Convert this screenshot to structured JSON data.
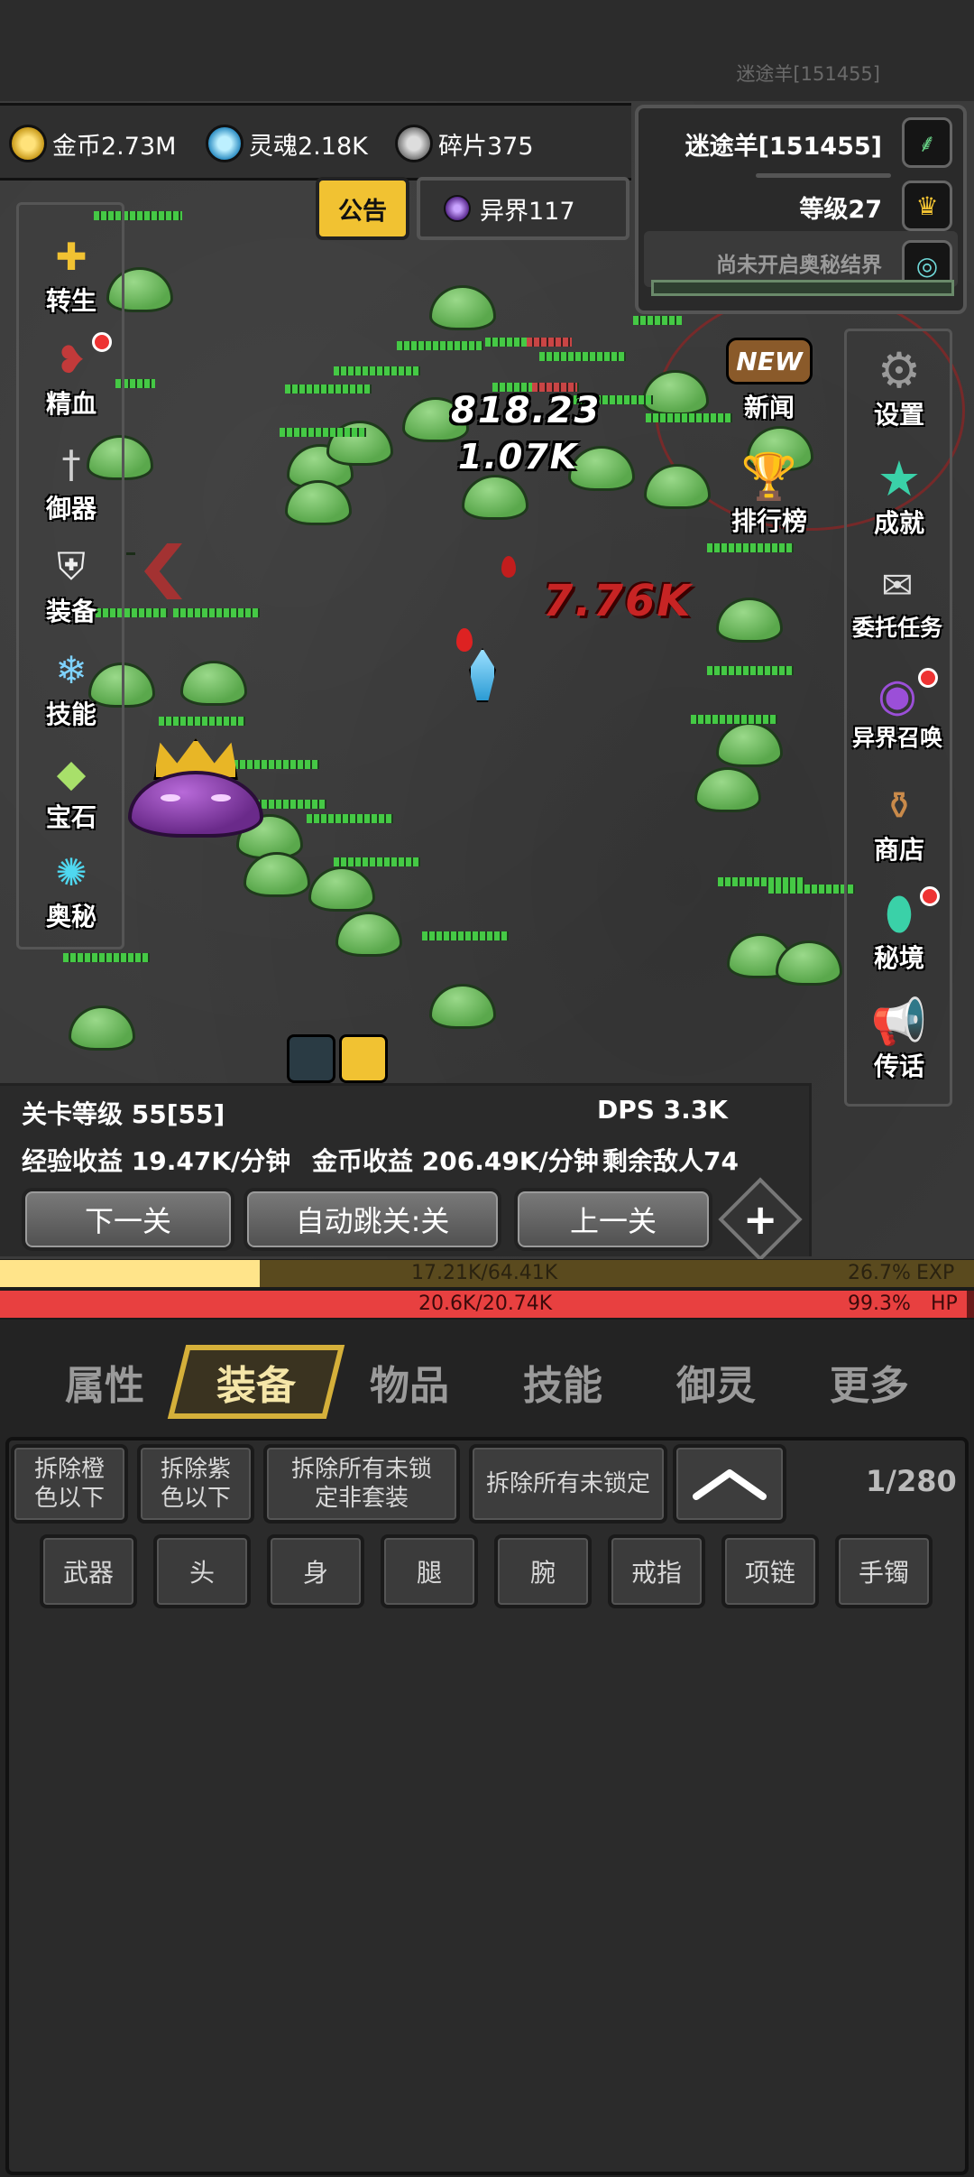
{
  "top": {
    "player_name_faint": "迷途羊[151455]"
  },
  "resources": [
    {
      "icon": "gold-coin-icon",
      "label": "金币2.73M"
    },
    {
      "icon": "soul-icon",
      "label": "灵魂2.18K"
    },
    {
      "icon": "fragment-icon",
      "label": "碎片375"
    }
  ],
  "notice": {
    "label": "公告"
  },
  "otherworld": {
    "label": "异界117"
  },
  "player": {
    "name": "迷途羊[151455]",
    "level": "等级27",
    "secret_realm": "尚未开启奥秘结界"
  },
  "left_menu": [
    {
      "label": "转生",
      "icon": "rebirth-icon"
    },
    {
      "label": "精血",
      "icon": "blood-essence-icon"
    },
    {
      "label": "御器",
      "icon": "sword-control-icon"
    },
    {
      "label": "装备",
      "icon": "equipment-icon"
    },
    {
      "label": "技能",
      "icon": "skill-icon"
    },
    {
      "label": "宝石",
      "icon": "gem-icon"
    },
    {
      "label": "奥秘",
      "icon": "mystery-icon"
    }
  ],
  "right_menu": [
    {
      "label": "新闻",
      "icon": "news-icon",
      "badge": "NEW"
    },
    {
      "label": "设置",
      "icon": "gear-icon"
    },
    {
      "label": "排行榜",
      "icon": "leaderboard-icon"
    },
    {
      "label": "成就",
      "icon": "achievement-icon"
    },
    {
      "label": "委托任务",
      "icon": "quest-icon"
    },
    {
      "label": "异界召唤",
      "icon": "summon-icon"
    },
    {
      "label": "商店",
      "icon": "shop-icon"
    },
    {
      "label": "秘境",
      "icon": "secret-land-icon"
    },
    {
      "label": "传话",
      "icon": "message-icon"
    }
  ],
  "damage": {
    "d1": "818.23",
    "d2": "1.07K",
    "d3": "7.76K"
  },
  "stage": {
    "level": "关卡等级 55[55]",
    "dps": "DPS 3.3K",
    "exp_income": "经验收益 19.47K/分钟",
    "gold_income": "金币收益 206.49K/分钟",
    "enemies_left": "剩余敌人74"
  },
  "stage_buttons": {
    "next": "下一关",
    "auto": "自动跳关:关",
    "prev": "上一关"
  },
  "exp": {
    "text": "17.21K/64.41K",
    "percent": "26.7%",
    "label": "EXP",
    "fill": 0.267
  },
  "hp": {
    "text": "20.6K/20.74K",
    "percent": "99.3%",
    "label": "HP",
    "fill": 0.993
  },
  "tabs": [
    "属性",
    "装备",
    "物品",
    "技能",
    "御灵",
    "更多"
  ],
  "actions": {
    "dismantle_orange": "拆除橙色以下",
    "dismantle_purple": "拆除紫色以下",
    "dismantle_unlocked_nonset": "拆除所有未锁定非套装",
    "dismantle_unlocked": "拆除所有未锁定"
  },
  "inventory_count": "1/280",
  "slots": [
    "武器",
    "头",
    "身",
    "腿",
    "腕",
    "戒指",
    "项链",
    "手镯"
  ],
  "colors": {
    "gold": "#f1c232",
    "exp": "#ffe48a",
    "hp": "#e84040",
    "slime": "#6bbf5a"
  }
}
